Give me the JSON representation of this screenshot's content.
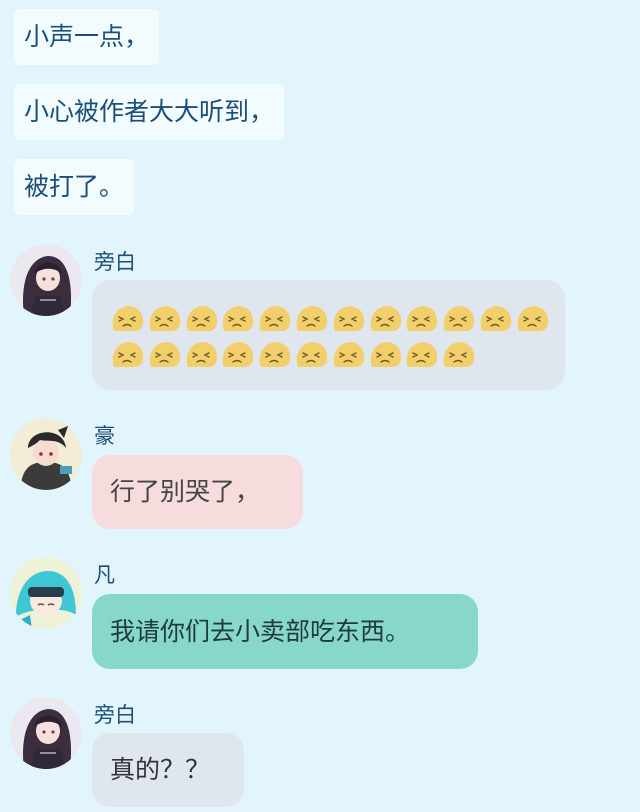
{
  "narration": [
    "小声一点，",
    "小心被作者大大听到，",
    "被打了。"
  ],
  "messages": [
    {
      "sender": "旁白",
      "text": ""
    },
    {
      "sender": "豪",
      "text": "行了别哭了，"
    },
    {
      "sender": "凡",
      "text": "我请你们去小卖部吃东西。"
    },
    {
      "sender": "旁白",
      "text": "真的？？"
    }
  ],
  "emoji": {
    "name": "crying-face-icon",
    "row1_count": 12,
    "row2_count": 10,
    "color": "#f2cf6a"
  },
  "colors": {
    "background": "#e2f5fc",
    "narration_bubble": "#f2fbfe",
    "bubble_grey": "#dfe6ee",
    "bubble_pink": "#f6dcdd",
    "bubble_teal": "#87d7cc",
    "name_text": "#1b4f7a"
  }
}
